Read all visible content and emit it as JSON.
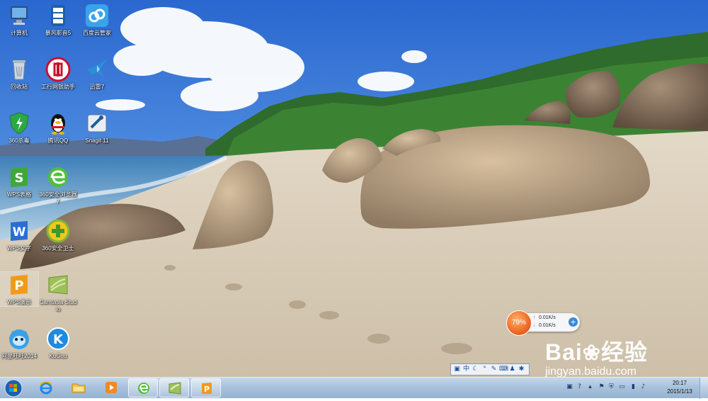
{
  "desktop": {
    "icons": [
      {
        "label": "计算机",
        "icon": "computer-icon"
      },
      {
        "label": "暴风影音5",
        "icon": "baofeng-player-icon"
      },
      {
        "label": "百度云管家",
        "icon": "baidu-cloud-icon"
      },
      {
        "label": "回收站",
        "icon": "recycle-bin-icon"
      },
      {
        "label": "工行网银助手",
        "icon": "icbc-bank-icon"
      },
      {
        "label": "迅雷7",
        "icon": "xunlei-icon"
      },
      {
        "label": "360杀毒",
        "icon": "360-antivirus-icon"
      },
      {
        "label": "腾讯QQ",
        "icon": "qq-penguin-icon"
      },
      {
        "label": "Snagit 11",
        "icon": "snagit-icon"
      },
      {
        "label": "WPS表格",
        "icon": "wps-spreadsheet-icon"
      },
      {
        "label": "360安全浏览器7",
        "icon": "360-browser-icon"
      },
      {
        "label": "WPS文字",
        "icon": "wps-writer-icon"
      },
      {
        "label": "360安全卫士",
        "icon": "360-safeguard-icon"
      },
      {
        "label": "WPS演示",
        "icon": "wps-presentation-icon"
      },
      {
        "label": "Camtasia Studio",
        "icon": "camtasia-icon"
      },
      {
        "label": "阿里旺旺2014",
        "icon": "aliwangwang-icon"
      },
      {
        "label": "KuGou",
        "icon": "kugou-icon"
      }
    ]
  },
  "network_widget": {
    "percent": "79%",
    "upload": "0.01K/s",
    "download": "0.01K/s"
  },
  "ime_bar": {
    "mode": "中"
  },
  "watermark": {
    "brand_left": "Bai",
    "brand_right": "经验",
    "url": "jingyan.baidu.com"
  },
  "taskbar": {
    "pinned": [
      "ie-icon",
      "explorer-folder-icon",
      "media-player-icon",
      "360-browser-icon",
      "camtasia-icon",
      "wps-presentation-icon"
    ],
    "clock_time": "20:17",
    "clock_date": "2015/1/13"
  },
  "colors": {
    "sky_top": "#2b6ad0",
    "sand": "#d7ccba",
    "taskbar": "#a9c2dc",
    "orange": "#ee6a24"
  }
}
